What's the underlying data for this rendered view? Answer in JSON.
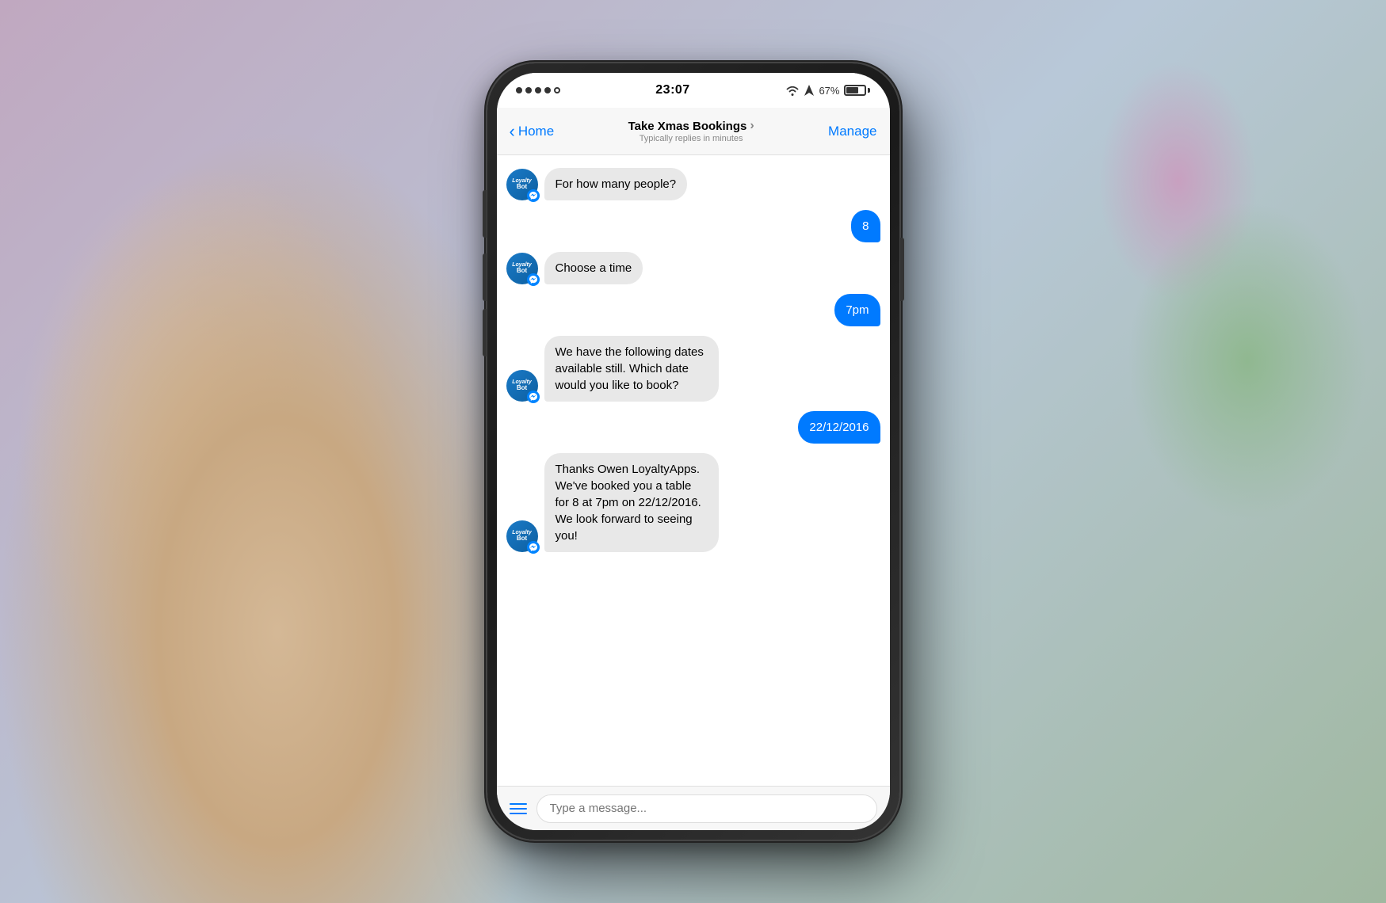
{
  "background": {
    "description": "Blurred bokeh background with hand holding phone"
  },
  "phone": {
    "status_bar": {
      "signal_dots": 4,
      "signal_hollow": 1,
      "time": "23:07",
      "battery_percent": "67%",
      "has_wifi": true,
      "has_location": true
    },
    "nav": {
      "back_label": "Home",
      "title": "Take Xmas Bookings",
      "subtitle": "Typically replies in minutes",
      "action_label": "Manage"
    },
    "messages": [
      {
        "id": "msg1",
        "type": "bot",
        "text": "For how many people?"
      },
      {
        "id": "msg2",
        "type": "user",
        "text": "8"
      },
      {
        "id": "msg3",
        "type": "bot",
        "text": "Choose a time"
      },
      {
        "id": "msg4",
        "type": "user",
        "text": "7pm"
      },
      {
        "id": "msg5",
        "type": "bot",
        "text": "We have the following dates available still. Which date would you like to book?"
      },
      {
        "id": "msg6",
        "type": "user",
        "text": "22/12/2016"
      },
      {
        "id": "msg7",
        "type": "bot",
        "text": "Thanks Owen LoyaltyApps. We've booked you a table for 8 at 7pm on 22/12/2016. We look forward to seeing you!"
      }
    ],
    "bottom_bar": {
      "input_placeholder": "Type a message..."
    }
  }
}
